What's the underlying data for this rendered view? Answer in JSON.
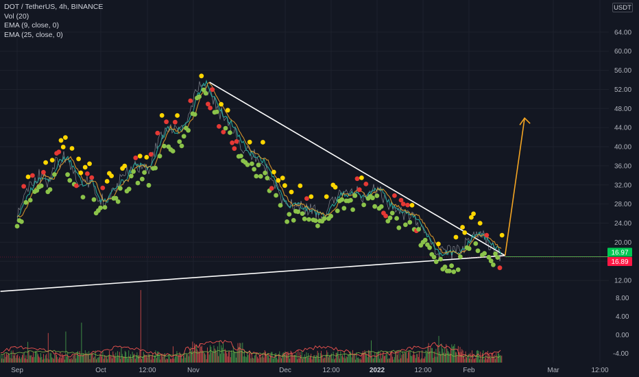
{
  "legend": {
    "symbol": "DOT / TetherUS, 4h, BINANCE",
    "vol": "Vol (20)",
    "ema1": "EMA (9, close, 0)",
    "ema2": "EMA (25, close, 0)"
  },
  "unit": "USDT",
  "colors": {
    "background": "#131722",
    "up_dot": "#8bc34a",
    "top_dot": "#ffd600",
    "down_dot": "#e53935",
    "ema_fast": "#26a69a",
    "ema_slow": "#f4a72e",
    "trendline": "#ffffff",
    "projection": "#f5a623",
    "support_extension": "#4caf50",
    "vol_up": "#4caf50",
    "vol_down": "#ef5350",
    "current_price": "#00c853",
    "last_price": "#ff1744"
  },
  "chart_data": {
    "type": "line",
    "price_axis": {
      "ticks": [
        "64.00",
        "60.00",
        "56.00",
        "52.00",
        "48.00",
        "44.00",
        "40.00",
        "36.00",
        "32.00",
        "28.00",
        "24.00",
        "20.00",
        "16.00",
        "12.00"
      ],
      "range": [
        10,
        68
      ]
    },
    "volume_axis": {
      "ticks": [
        "8.00",
        "4.00",
        "0.00",
        "-4.00"
      ],
      "range": [
        -6,
        10
      ]
    },
    "x_labels": [
      "Sep",
      "Oct",
      "12:00",
      "Nov",
      "Dec",
      "12:00",
      "2022",
      "12:00",
      "Feb",
      "Mar",
      "12:00"
    ],
    "price_tags": {
      "green": "16.97",
      "red": "16.89"
    },
    "series": [
      {
        "name": "DOT / TetherUS",
        "x": [
          "2021-09-01",
          "2021-09-05",
          "2021-09-09",
          "2021-09-12",
          "2021-09-15",
          "2021-09-18",
          "2021-09-21",
          "2021-09-24",
          "2021-09-27",
          "2021-09-30",
          "2021-10-03",
          "2021-10-06",
          "2021-10-09",
          "2021-10-12",
          "2021-10-15",
          "2021-10-18",
          "2021-10-21",
          "2021-10-24",
          "2021-10-27",
          "2021-10-30",
          "2021-11-02",
          "2021-11-04",
          "2021-11-07",
          "2021-11-10",
          "2021-11-13",
          "2021-11-16",
          "2021-11-19",
          "2021-11-22",
          "2021-11-25",
          "2021-11-28",
          "2021-12-01",
          "2021-12-04",
          "2021-12-07",
          "2021-12-10",
          "2021-12-13",
          "2021-12-16",
          "2021-12-19",
          "2021-12-22",
          "2021-12-25",
          "2021-12-28",
          "2021-12-31",
          "2022-01-03",
          "2022-01-06",
          "2022-01-09",
          "2022-01-12",
          "2022-01-15",
          "2022-01-18",
          "2022-01-21",
          "2022-01-24",
          "2022-01-27",
          "2022-01-30",
          "2022-02-02",
          "2022-02-05",
          "2022-02-08",
          "2022-02-11",
          "2022-02-14",
          "2022-02-17",
          "2022-02-20",
          "2022-02-22"
        ],
        "values": [
          25.5,
          31,
          34,
          33,
          36.5,
          38,
          35,
          32,
          33,
          28.5,
          29,
          32,
          33,
          36,
          36,
          35.5,
          40,
          44,
          43,
          44,
          47,
          51,
          53.5,
          50,
          47,
          45,
          42,
          39,
          38,
          37,
          33.5,
          30,
          27.5,
          28,
          27,
          26.5,
          25.5,
          27,
          30,
          30,
          31,
          29,
          31,
          31,
          28,
          27,
          26,
          25.5,
          23,
          20,
          17.5,
          18,
          17.5,
          19,
          21.5,
          21.5,
          20,
          18.5,
          16.9
        ]
      }
    ],
    "trendlines": [
      {
        "name": "descending resistance",
        "from": [
          "2021-11-09",
          53.5
        ],
        "to": [
          "2022-02-23",
          17.2
        ]
      },
      {
        "name": "ascending support",
        "from": [
          "2021-08-26",
          9.7
        ],
        "to": [
          "2022-02-23",
          17.2
        ]
      }
    ],
    "projection_arrow": {
      "from": [
        "2022-02-23",
        17.2
      ],
      "to": [
        "2022-03-02",
        46
      ]
    },
    "ylim": [
      10,
      68
    ],
    "grid": true
  }
}
